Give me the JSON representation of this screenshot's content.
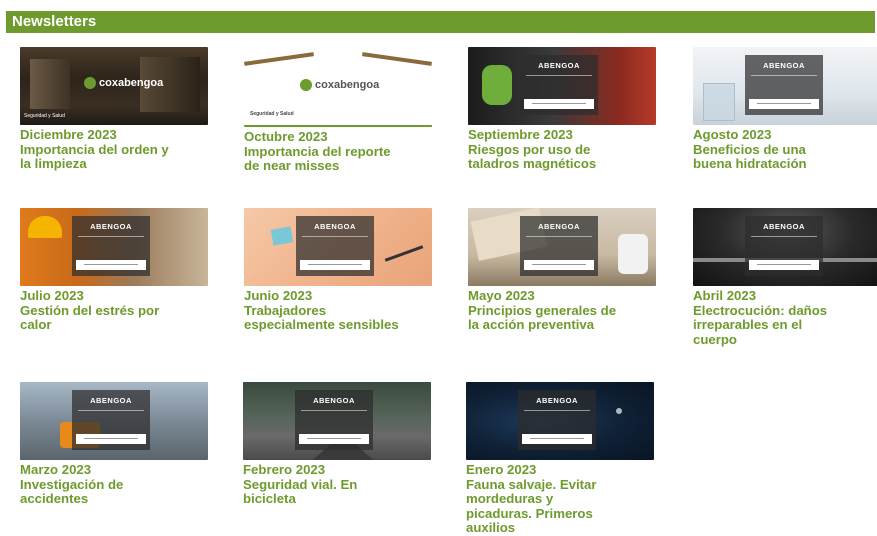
{
  "header": {
    "title": "Newsletters"
  },
  "brand": {
    "cox": "coxabengoa",
    "abengoa": "ABENGOA",
    "seguridad": "Seguridad y Salud"
  },
  "newsletters": [
    {
      "month": "Diciembre 2023",
      "lines": [
        "Importancia del orden y",
        "la limpieza"
      ]
    },
    {
      "month": "Octubre 2023",
      "lines": [
        "Importancia del reporte",
        "de near misses"
      ]
    },
    {
      "month": "Septiembre 2023",
      "lines": [
        "Riesgos por uso de",
        "taladros magnéticos"
      ]
    },
    {
      "month": "Agosto 2023",
      "lines": [
        "Beneficios de una",
        "buena hidratación"
      ]
    },
    {
      "month": "Julio 2023",
      "lines": [
        "Gestión del estrés por",
        "calor"
      ]
    },
    {
      "month": "Junio 2023",
      "lines": [
        "Trabajadores",
        "especialmente sensibles"
      ]
    },
    {
      "month": "Mayo 2023",
      "lines": [
        "Principios generales de",
        "la acción preventiva"
      ]
    },
    {
      "month": "Abril 2023",
      "lines": [
        "Electrocución: daños",
        "irreparables en el",
        "cuerpo"
      ]
    },
    {
      "month": "Marzo 2023",
      "lines": [
        "Investigación de",
        "accidentes"
      ]
    },
    {
      "month": "Febrero 2023",
      "lines": [
        "Seguridad vial. En",
        "bicicleta"
      ]
    },
    {
      "month": "Enero 2023",
      "lines": [
        "Fauna salvaje. Evitar",
        "mordeduras y",
        "picaduras. Primeros",
        "auxilios"
      ]
    }
  ]
}
